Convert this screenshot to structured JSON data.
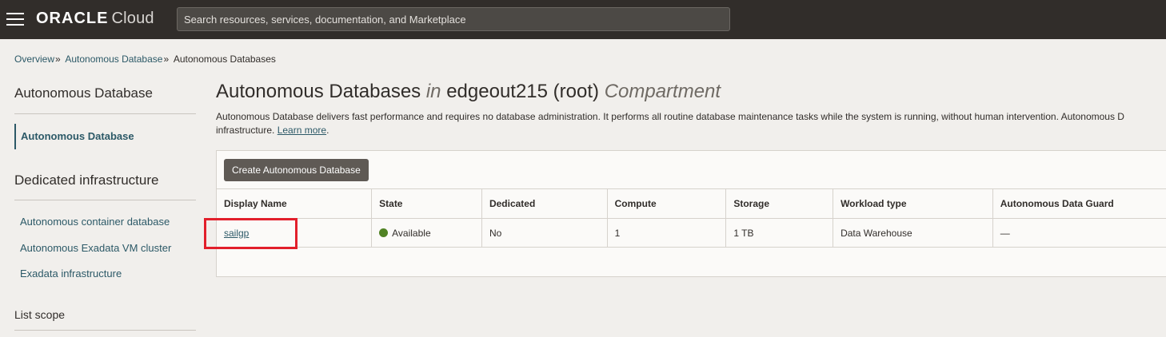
{
  "topbar": {
    "brand": "ORACLE",
    "product": "Cloud",
    "search_placeholder": "Search resources, services, documentation, and Marketplace"
  },
  "breadcrumb": {
    "items": [
      "Overview",
      "Autonomous Database",
      "Autonomous Databases"
    ]
  },
  "sidebar": {
    "heading": "Autonomous Database",
    "active_item": "Autonomous Database",
    "dedicated_heading": "Dedicated infrastructure",
    "dedicated_items": [
      "Autonomous container database",
      "Autonomous Exadata VM cluster",
      "Exadata infrastructure"
    ],
    "list_scope": "List scope"
  },
  "main": {
    "title_part1": "Autonomous Databases",
    "title_in": "in",
    "title_compartment_name": "edgeout215 (root)",
    "title_compartment": "Compartment",
    "description_line1": "Autonomous Database delivers fast performance and requires no database administration. It performs all routine database maintenance tasks while the system is running, without human intervention. Autonomous D",
    "description_line2": "infrastructure.",
    "learn_more": "Learn more",
    "create_button": "Create Autonomous Database",
    "table": {
      "headers": [
        "Display Name",
        "State",
        "Dedicated",
        "Compute",
        "Storage",
        "Workload type",
        "Autonomous Data Guard"
      ],
      "rows": [
        {
          "display_name": "sailgp",
          "state": "Available",
          "dedicated": "No",
          "compute": "1",
          "storage": "1 TB",
          "workload_type": "Data Warehouse",
          "data_guard": "—"
        }
      ]
    }
  },
  "colors": {
    "topbar": "#312d2a",
    "link": "#2c5967",
    "status_available": "#508223",
    "highlight": "#e21f2b"
  }
}
